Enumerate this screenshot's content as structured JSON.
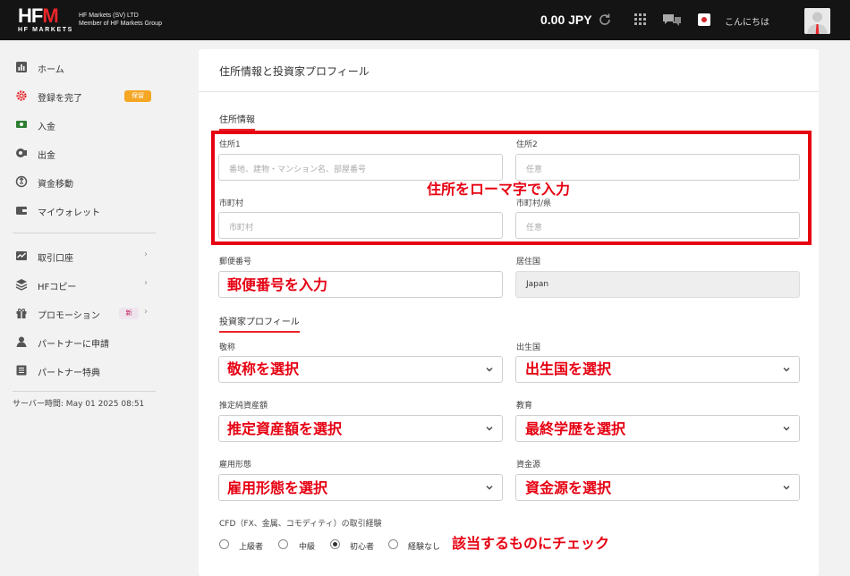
{
  "topbar": {
    "logo_text": "HFM",
    "logo_sub": "HF MARKETS",
    "company_line1": "HF Markets (SV) LTD",
    "company_line2": "Member of HF Markets Group",
    "balance": "0.00 JPY",
    "greeting": "こんにちは",
    "icons": [
      "refresh-icon",
      "apps-grid-icon",
      "chat-icon",
      "japan-flag-icon",
      "user-avatar"
    ]
  },
  "sidebar": {
    "items": [
      {
        "label": "ホーム",
        "icon": "chart-icon"
      },
      {
        "label": "登録を完了",
        "icon": "gear-icon",
        "badge": "保留"
      },
      {
        "label": "入金",
        "icon": "deposit-icon"
      },
      {
        "label": "出金",
        "icon": "withdraw-icon"
      },
      {
        "label": "資金移動",
        "icon": "transfer-icon"
      },
      {
        "label": "マイウォレット",
        "icon": "wallet-icon"
      },
      {
        "label": "取引口座",
        "icon": "trading-account-icon"
      },
      {
        "label": "HFコピー",
        "icon": "layers-icon"
      },
      {
        "label": "プロモーション",
        "icon": "gift-icon",
        "badge": "新"
      },
      {
        "label": "パートナーに申請",
        "icon": "person-icon"
      },
      {
        "label": "パートナー特典",
        "icon": "list-icon"
      }
    ],
    "server_time": "サーバー時間:   May 01 2025 08:51"
  },
  "main": {
    "title": "住所情報と投資家プロフィール",
    "address_section": "住所情報",
    "address1_label": "住所1",
    "address1_placeholder": "番地、建物・マンション名、部屋番号",
    "address2_label": "住所2",
    "address2_placeholder": "任意",
    "city_label": "市町村",
    "city_placeholder": "市町村",
    "state_label": "市町村/県",
    "state_placeholder": "任意",
    "postal_label": "郵便番号",
    "country_label": "居住国",
    "country_value": "Japan",
    "investor_section": "投資家プロフィール",
    "title_label": "敬称",
    "birth_country_label": "出生国",
    "net_worth_label": "推定純資産額",
    "education_label": "教育",
    "employment_label": "雇用形態",
    "funds_source_label": "資金源",
    "cfd_label": "CFD（FX、金属、コモディティ）の取引経験",
    "cfd_options": [
      {
        "label": "上級者",
        "checked": false
      },
      {
        "label": "中級",
        "checked": false
      },
      {
        "label": "初心者",
        "checked": true
      },
      {
        "label": "経験なし",
        "checked": false
      }
    ]
  },
  "annotations": {
    "address": "住所をローマ字で入力",
    "postal": "郵便番号を入力",
    "title": "敬称を選択",
    "birth_country": "出生国を選択",
    "net_worth": "推定資産額を選択",
    "education": "最終学歴を選択",
    "employment": "雇用形態を選択",
    "funds_source": "資金源を選択",
    "cfd": "該当するものにチェック",
    "color": "#e60012"
  }
}
